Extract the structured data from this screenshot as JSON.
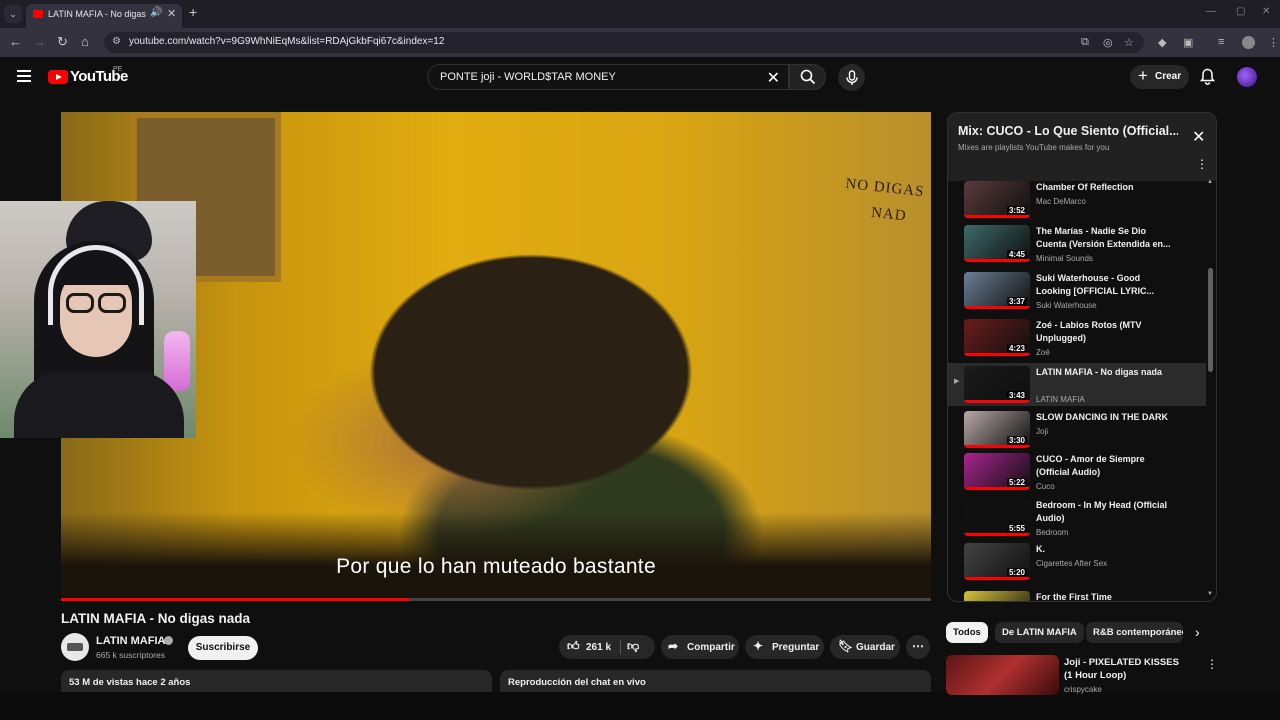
{
  "browser": {
    "tab_title": "LATIN MAFIA - No digas nada",
    "url": "youtube.com/watch?v=9G9WhNiEqMs&list=RDAjGkbFqi67c&index=12"
  },
  "header": {
    "logo_text": "YouTube",
    "country_code": "PE",
    "search_value": "PONTE joji - WORLD$TAR MONEY",
    "create_label": "Crear"
  },
  "video": {
    "subtitle": "Por que lo han muteado bastante",
    "wall_text": "NO DIGAS NAD",
    "progress_fraction": 0.4,
    "title": "LATIN MAFIA - No digas nada"
  },
  "channel": {
    "name": "LATIN MAFIA",
    "subscribers": "665 k suscriptores",
    "subscribe_label": "Suscribirse"
  },
  "actions": {
    "likes": "261 k",
    "share": "Compartir",
    "ask": "Preguntar",
    "save": "Guardar"
  },
  "description": {
    "views_date": "53 M de vistas  hace 2 años",
    "chat_replay": "Reproducción del chat en vivo"
  },
  "playlist": {
    "title": "Mix: CUCO - Lo Que Siento (Official...",
    "subtitle": "Mixes are playlists YouTube makes for you",
    "items": [
      {
        "title": "Chamber Of Reflection",
        "channel": "Mac DeMarco",
        "duration": "3:52",
        "color": "#5a3b3b"
      },
      {
        "title": "The Marías - Nadie Se Dio Cuenta (Versión Extendida en...",
        "channel": "Minimal Sounds",
        "duration": "4:45",
        "color": "#3d6a6a"
      },
      {
        "title": "Suki Waterhouse - Good Looking [OFFICIAL LYRIC...",
        "channel": "Suki Waterhouse",
        "duration": "3:37",
        "color": "#6a7f95"
      },
      {
        "title": "Zoé - Labios Rotos (MTV Unplugged)",
        "channel": "Zoé",
        "duration": "4:23",
        "color": "#6b1d1d"
      },
      {
        "title": "LATIN MAFIA - No digas nada",
        "channel": "LATIN MAFIA",
        "duration": "3:43",
        "color": "#1a1a1a"
      },
      {
        "title": "SLOW DANCING IN THE DARK",
        "channel": "Joji",
        "duration": "3:30",
        "color": "#b9a8a8"
      },
      {
        "title": "CUCO - Amor de Siempre (Official Audio)",
        "channel": "Cuco",
        "duration": "5:22",
        "color": "#a8258f"
      },
      {
        "title": "Bedroom - In My Head (Official Audio)",
        "channel": "Bedroom",
        "duration": "5:55",
        "color": "#111111"
      },
      {
        "title": "K.",
        "channel": "Cigarettes After Sex",
        "duration": "5:20",
        "color": "#444444"
      },
      {
        "title": "For the First Time",
        "channel": "",
        "duration": "",
        "color": "#d6c23a"
      }
    ]
  },
  "chips": [
    "Todos",
    "De LATIN MAFIA",
    "R&B contemporáneo"
  ],
  "recommended": {
    "title": "Joji - PIXELATED KISSES (1 Hour Loop)",
    "channel": "crispycake"
  }
}
